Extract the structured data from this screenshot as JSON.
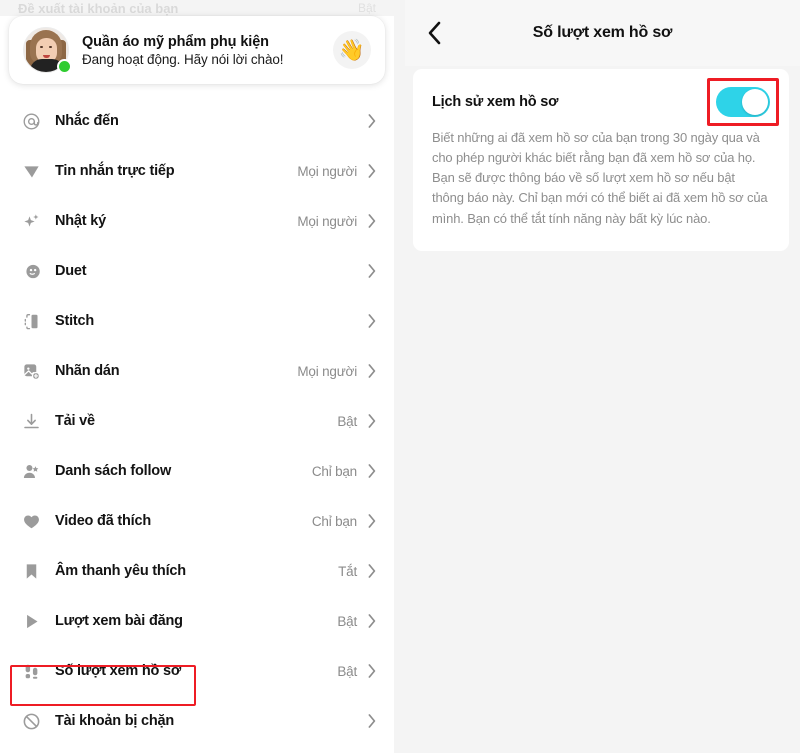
{
  "left": {
    "ghost_row": {
      "label": "Đề xuất tài khoản của bạn",
      "value": "Bật"
    },
    "profile": {
      "name": "Quần áo mỹ phẩm phụ kiện",
      "status": "Đang hoạt động. Hãy nói lời chào!",
      "wave_emoji": "👋",
      "avatar_name": "user-avatar",
      "online": true
    },
    "items": [
      {
        "icon": "at-sign-icon",
        "label": "Nhắc đến",
        "value": ""
      },
      {
        "icon": "paper-plane-icon",
        "label": "Tin nhắn trực tiếp",
        "value": "Mọi người"
      },
      {
        "icon": "sparkle-icon",
        "label": "Nhật ký",
        "value": "Mọi người"
      },
      {
        "icon": "duet-icon",
        "label": "Duet",
        "value": ""
      },
      {
        "icon": "stitch-icon",
        "label": "Stitch",
        "value": ""
      },
      {
        "icon": "sticker-icon",
        "label": "Nhãn dán",
        "value": "Mọi người"
      },
      {
        "icon": "download-icon",
        "label": "Tải về",
        "value": "Bật"
      },
      {
        "icon": "people-icon",
        "label": "Danh sách follow",
        "value": "Chỉ bạn"
      },
      {
        "icon": "heart-icon",
        "label": "Video đã thích",
        "value": "Chỉ bạn"
      },
      {
        "icon": "bookmark-icon",
        "label": "Âm thanh yêu thích",
        "value": "Tắt"
      },
      {
        "icon": "play-icon",
        "label": "Lượt xem bài đăng",
        "value": "Bật"
      },
      {
        "icon": "footsteps-icon",
        "label": "Số lượt xem hồ sơ",
        "value": "Bật"
      },
      {
        "icon": "blocked-icon",
        "label": "Tài khoản bị chặn",
        "value": ""
      }
    ],
    "highlight_index": 11
  },
  "right": {
    "back_label": "Quay lại",
    "title": "Số lượt xem hồ sơ",
    "setting": {
      "title": "Lịch sử xem hồ sơ",
      "toggle_on": true,
      "toggle_state_label": "Bật",
      "description": "Biết những ai đã xem hồ sơ của bạn trong 30 ngày qua và cho phép người khác biết rằng bạn đã xem hồ sơ của họ. Bạn sẽ được thông báo về số lượt xem hồ sơ nếu bật thông báo này. Chỉ bạn mới có thể biết ai đã xem hồ sơ của mình. Bạn có thể tắt tính năng này bất kỳ lúc nào."
    }
  },
  "colors": {
    "accent_toggle": "#2ed3e8",
    "highlight_red": "#ee1c24",
    "online_green": "#2fcc30",
    "text_primary": "#131313",
    "text_muted": "#8b8b8b",
    "panel_bg": "#f4f4f4"
  }
}
